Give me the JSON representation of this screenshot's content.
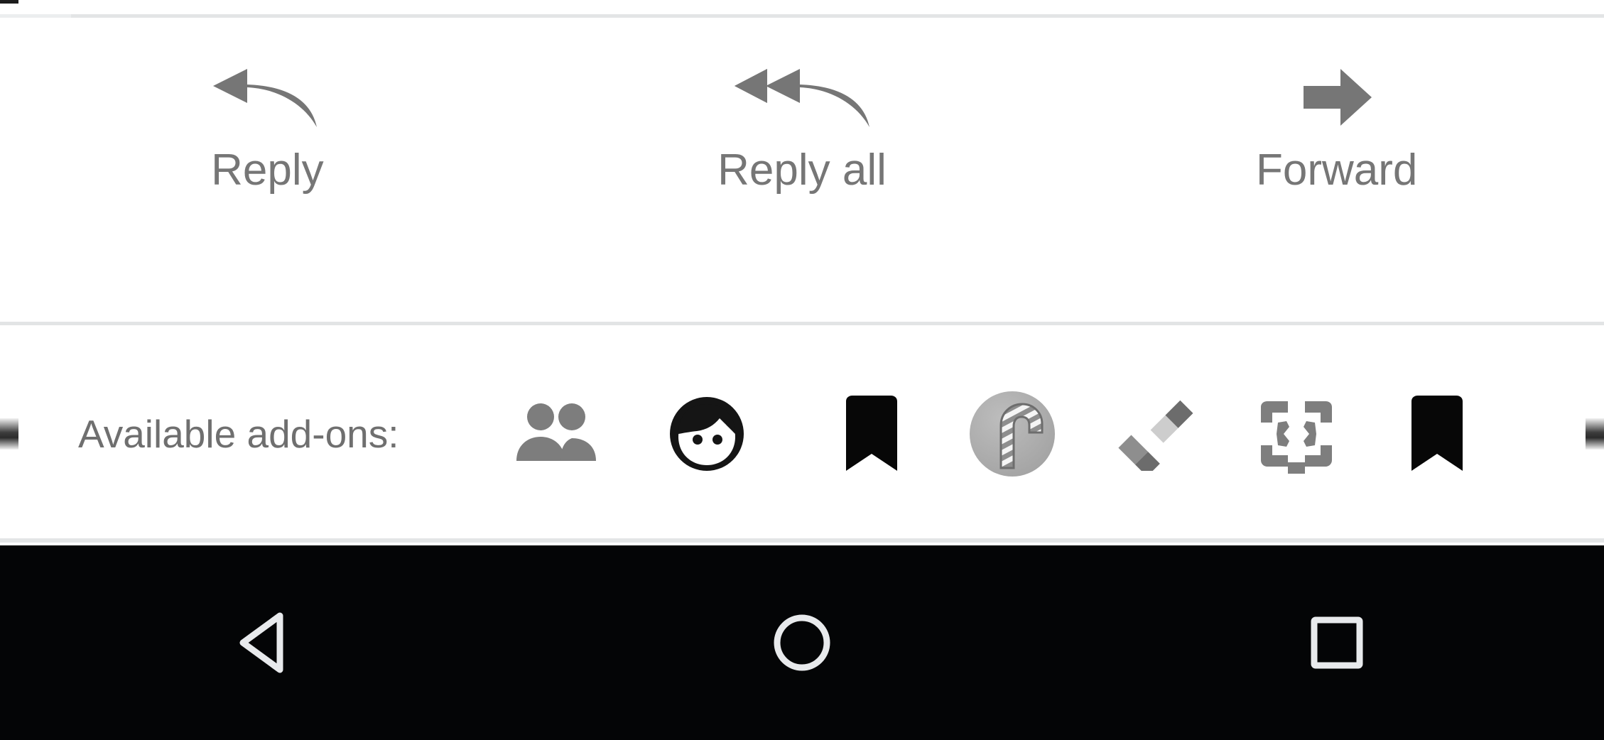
{
  "screen": {
    "app_context": "email-message-view",
    "background": "#ffffff"
  },
  "action_bar": {
    "items": [
      {
        "label": "Reply",
        "icon": "reply-arrow-icon",
        "color": "#767676"
      },
      {
        "label": "Reply all",
        "icon": "reply-all-arrow-icon",
        "color": "#767676"
      },
      {
        "label": "Forward",
        "icon": "forward-arrow-icon",
        "color": "#767676"
      }
    ]
  },
  "addons": {
    "label": "Available add-ons:",
    "label_color": "#6f6f6f",
    "items": [
      {
        "icon": "people-group-icon",
        "color": "#7d7d7d"
      },
      {
        "icon": "person-face-icon",
        "color": "#151515"
      },
      {
        "icon": "bookmark-icon",
        "color": "#070707"
      },
      {
        "icon": "candy-cane-circle-icon",
        "color": "#a8a8a8"
      },
      {
        "icon": "checkmark-icon",
        "color": "#8a8a8a"
      },
      {
        "icon": "code-brackets-icon",
        "color": "#7e7e7e"
      },
      {
        "icon": "bookmark-icon",
        "color": "#070707"
      }
    ],
    "clipped_left_icon": "clipped-addon-icon",
    "clipped_right_icon": "clipped-addon-icon"
  },
  "navigation_bar": {
    "background": "#040506",
    "icon_color": "#e8eaec",
    "buttons": [
      {
        "name": "back-button",
        "icon": "back-triangle-icon"
      },
      {
        "name": "home-button",
        "icon": "home-circle-icon"
      },
      {
        "name": "recents-button",
        "icon": "recents-square-icon"
      }
    ]
  }
}
